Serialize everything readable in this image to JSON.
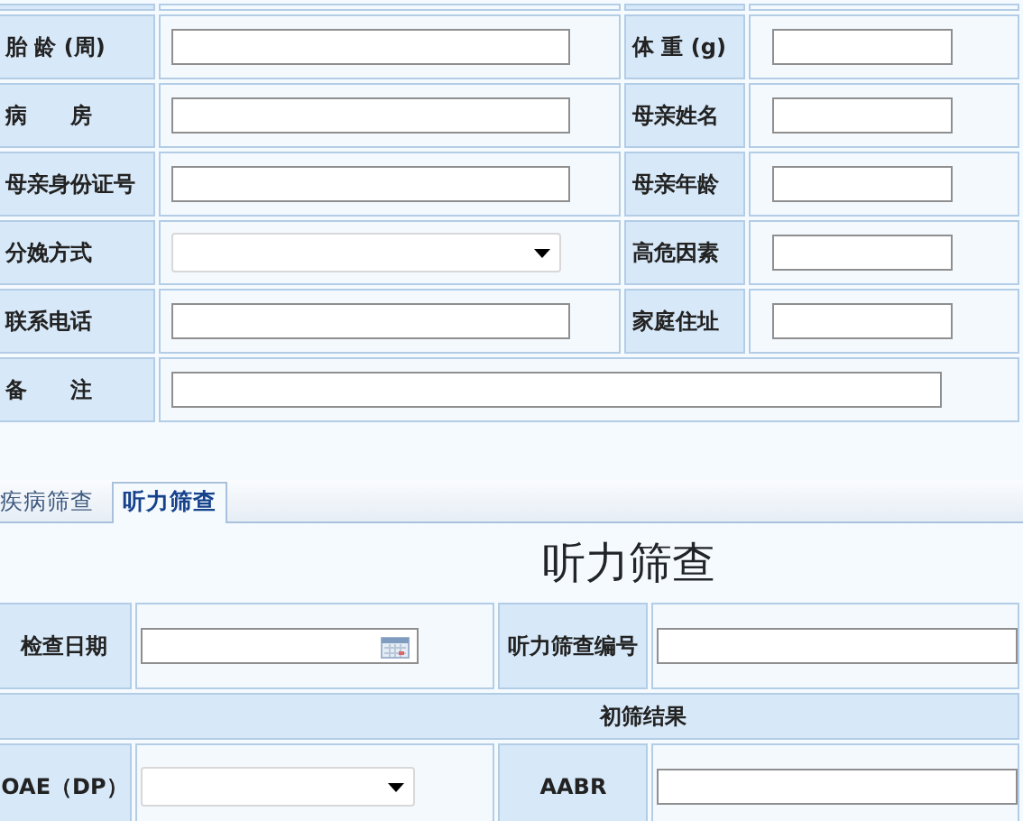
{
  "patient_form": {
    "rows": [
      {
        "fields": [
          {
            "label": "胎 龄 (周)",
            "kind": "text"
          },
          {
            "label": "体 重 (g)",
            "kind": "text"
          }
        ]
      },
      {
        "fields": [
          {
            "label": "病　　房",
            "kind": "text"
          },
          {
            "label": "母亲姓名",
            "kind": "text"
          }
        ]
      },
      {
        "fields": [
          {
            "label": "母亲身份证号",
            "kind": "text"
          },
          {
            "label": "母亲年龄",
            "kind": "text"
          }
        ]
      },
      {
        "fields": [
          {
            "label": "分娩方式",
            "kind": "select"
          },
          {
            "label": "高危因素",
            "kind": "text"
          }
        ]
      },
      {
        "fields": [
          {
            "label": "联系电话",
            "kind": "text"
          },
          {
            "label": "家庭住址",
            "kind": "text"
          }
        ]
      },
      {
        "fields": [
          {
            "label": "备　　注",
            "kind": "wide"
          }
        ]
      }
    ]
  },
  "tabs": [
    {
      "label": "疾病筛查",
      "selected": false
    },
    {
      "label": "听力筛查",
      "selected": true
    }
  ],
  "hearing": {
    "title": "听力筛查",
    "rows": [
      {
        "kind": "fields",
        "fields": [
          {
            "label": "检查日期",
            "kind": "date"
          },
          {
            "label": "听力筛查编号",
            "kind": "text"
          }
        ]
      },
      {
        "kind": "section",
        "label": "初筛结果"
      },
      {
        "kind": "fields",
        "fields": [
          {
            "label": "OAE（DP）",
            "kind": "select"
          },
          {
            "label": "AABR",
            "kind": "text"
          }
        ]
      }
    ]
  }
}
